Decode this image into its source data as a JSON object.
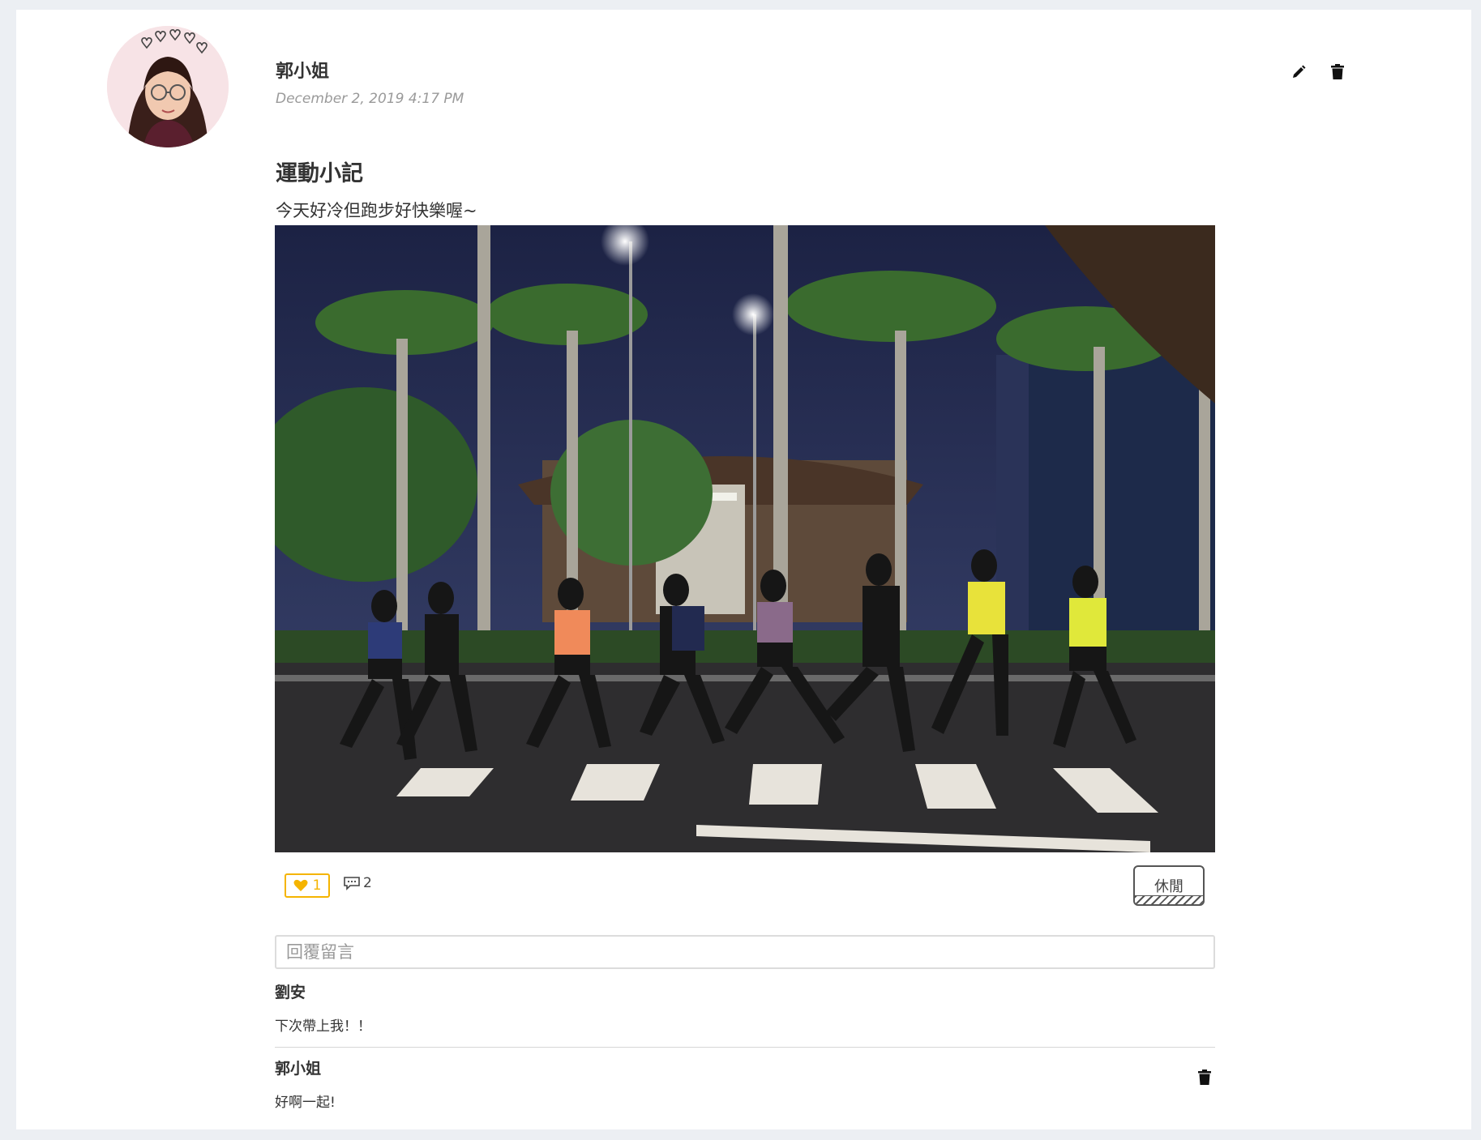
{
  "post": {
    "author": "郭小姐",
    "date": "December 2, 2019 4:17 PM",
    "title": "運動小記",
    "body": "今天好冷但跑步好快樂喔~",
    "photo_subject": "night-running-group-photo",
    "likes": "1",
    "comments_count": "2",
    "tag": "休閒",
    "actions": {
      "edit_icon": "pencil-icon",
      "delete_icon": "trash-icon"
    }
  },
  "reply": {
    "placeholder": "回覆留言"
  },
  "comments": [
    {
      "author": "劉安",
      "text": "下次帶上我！！"
    },
    {
      "author": "郭小姐",
      "text": "好啊一起!",
      "delete_icon": "trash-icon"
    }
  ],
  "colors": {
    "like_accent": "#f5b400",
    "page_background": "#eceff3",
    "card_background": "#ffffff"
  }
}
